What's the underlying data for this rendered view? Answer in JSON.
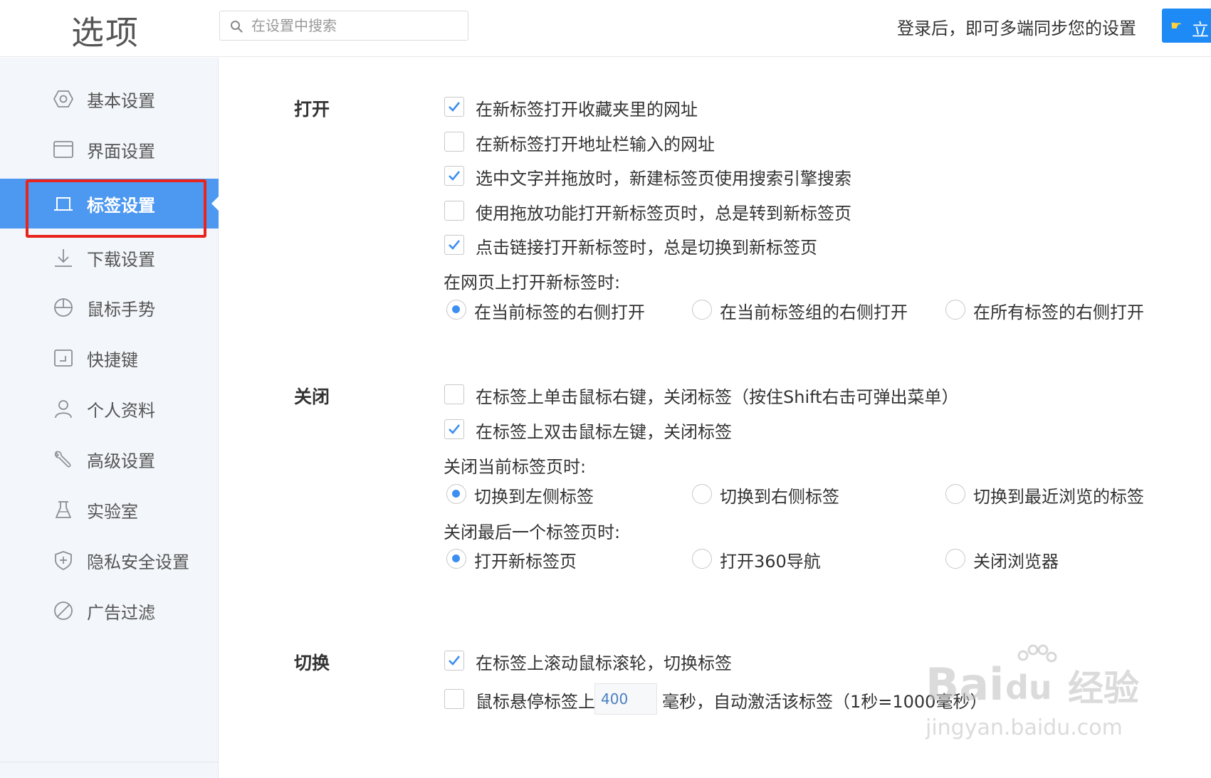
{
  "header": {
    "title": "选项",
    "search_placeholder": "在设置中搜索",
    "sync_text": "登录后，即可多端同步您的设置",
    "login_button": "立"
  },
  "sidebar": {
    "items": [
      {
        "label": "基本设置",
        "icon": "settings-hexagon-icon"
      },
      {
        "label": "界面设置",
        "icon": "window-icon"
      },
      {
        "label": "标签设置",
        "icon": "tab-icon",
        "active": true
      },
      {
        "label": "下载设置",
        "icon": "download-icon"
      },
      {
        "label": "鼠标手势",
        "icon": "mouse-icon"
      },
      {
        "label": "快捷键",
        "icon": "keyboard-icon"
      },
      {
        "label": "个人资料",
        "icon": "user-icon"
      },
      {
        "label": "高级设置",
        "icon": "wrench-icon"
      },
      {
        "label": "实验室",
        "icon": "flask-icon"
      },
      {
        "label": "隐私安全设置",
        "icon": "shield-icon"
      },
      {
        "label": "广告过滤",
        "icon": "block-icon"
      }
    ]
  },
  "open": {
    "title": "打开",
    "options": [
      {
        "label": "在新标签打开收藏夹里的网址",
        "checked": true
      },
      {
        "label": "在新标签打开地址栏输入的网址",
        "checked": false
      },
      {
        "label": "选中文字并拖放时，新建标签页使用搜索引擎搜索",
        "checked": true
      },
      {
        "label": "使用拖放功能打开新标签页时，总是转到新标签页",
        "checked": false
      },
      {
        "label": "点击链接打开新标签时，总是切换到新标签页",
        "checked": true
      }
    ],
    "new_tab_position": {
      "label": "在网页上打开新标签时:",
      "choices": [
        "在当前标签的右侧打开",
        "在当前标签组的右侧打开",
        "在所有标签的右侧打开"
      ],
      "selected": 0
    }
  },
  "close": {
    "title": "关闭",
    "options": [
      {
        "label": "在标签上单击鼠标右键，关闭标签（按住Shift右击可弹出菜单）",
        "checked": false
      },
      {
        "label": "在标签上双击鼠标左键，关闭标签",
        "checked": true
      }
    ],
    "on_close_current": {
      "label": "关闭当前标签页时:",
      "choices": [
        "切换到左侧标签",
        "切换到右侧标签",
        "切换到最近浏览的标签"
      ],
      "selected": 0
    },
    "on_close_last": {
      "label": "关闭最后一个标签页时:",
      "choices": [
        "打开新标签页",
        "打开360导航",
        "关闭浏览器"
      ],
      "selected": 0
    }
  },
  "switch": {
    "title": "切换",
    "options": [
      {
        "label": "在标签上滚动鼠标滚轮，切换标签",
        "checked": true
      },
      {
        "label": "鼠标悬停标签上",
        "checked": false
      }
    ],
    "hover_delay_value": "400",
    "hover_delay_suffix": "毫秒，自动激活该标签（1秒=1000毫秒）"
  },
  "watermark": {
    "brand": "Bai",
    "brand_du": "du",
    "brand_cn": "经验",
    "url": "jingyan.baidu.com"
  },
  "colors": {
    "accent": "#4d98f0",
    "highlight": "#e8241c",
    "button": "#1e8af5"
  }
}
